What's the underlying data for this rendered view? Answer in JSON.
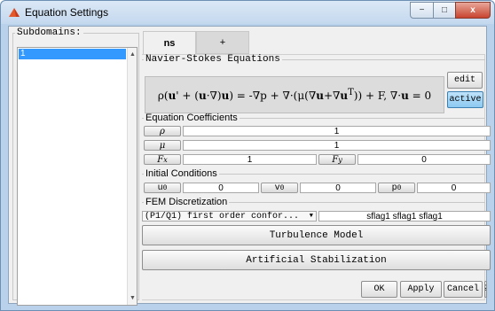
{
  "window": {
    "title": "Equation Settings"
  },
  "title_controls": {
    "minimize": "−",
    "maximize": "□",
    "close": "x"
  },
  "subdomains": {
    "legend": "Subdomains:",
    "items": [
      "1"
    ]
  },
  "tabs": [
    {
      "label": "ns",
      "active": true
    },
    {
      "label": "+",
      "active": false
    }
  ],
  "navier_stokes": {
    "legend": "Navier-Stokes Equations",
    "edit_label": "edit",
    "active_label": "active"
  },
  "coefficients": {
    "legend": "Equation Coefficients",
    "rho_value": "1",
    "mu_value": "1",
    "fx_value": "1",
    "fy_value": "0"
  },
  "initial_conditions": {
    "legend": "Initial Conditions",
    "u0_value": "0",
    "v0_value": "0",
    "p0_value": "0"
  },
  "fem": {
    "legend": "FEM Discretization",
    "selected": "(P1/Q1) first order confor...",
    "sflags": "sflag1 sflag1 sflag1"
  },
  "buttons": {
    "turbulence": "Turbulence Model",
    "stabilization": "Artificial Stabilization",
    "ok": "OK",
    "apply": "Apply",
    "cancel": "Cancel",
    "help": "?"
  },
  "colors": {
    "selection": "#3399ff",
    "active_button": "#8cc9f1",
    "dialog_bg": "#f0f0f0"
  }
}
